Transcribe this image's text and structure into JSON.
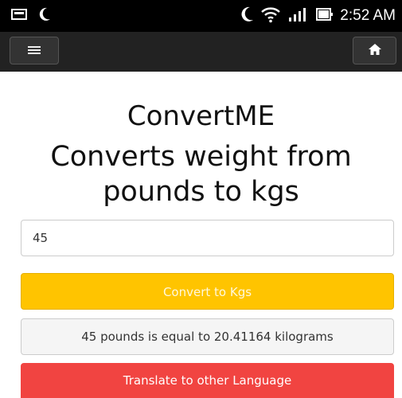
{
  "status_bar": {
    "time": "2:52 AM",
    "icons": [
      "photo-icon",
      "moon-icon",
      "moon-icon",
      "wifi-icon",
      "signal-icon",
      "battery-icon"
    ]
  },
  "nav": {
    "menu_icon": "hamburger-icon",
    "home_icon": "home-icon"
  },
  "main": {
    "title": "ConvertME",
    "subtitle_line1": "Converts weight from",
    "subtitle_line2": "pounds to kgs",
    "input_value": "45",
    "convert_label": "Convert to Kgs",
    "result_text": "45 pounds is equal to 20.41164 kilograms",
    "translate_label": "Translate to other Language"
  },
  "colors": {
    "convert_button": "#ffc400",
    "translate_button": "#f14441",
    "nav_bar": "#222222",
    "status_bar": "#000000"
  }
}
